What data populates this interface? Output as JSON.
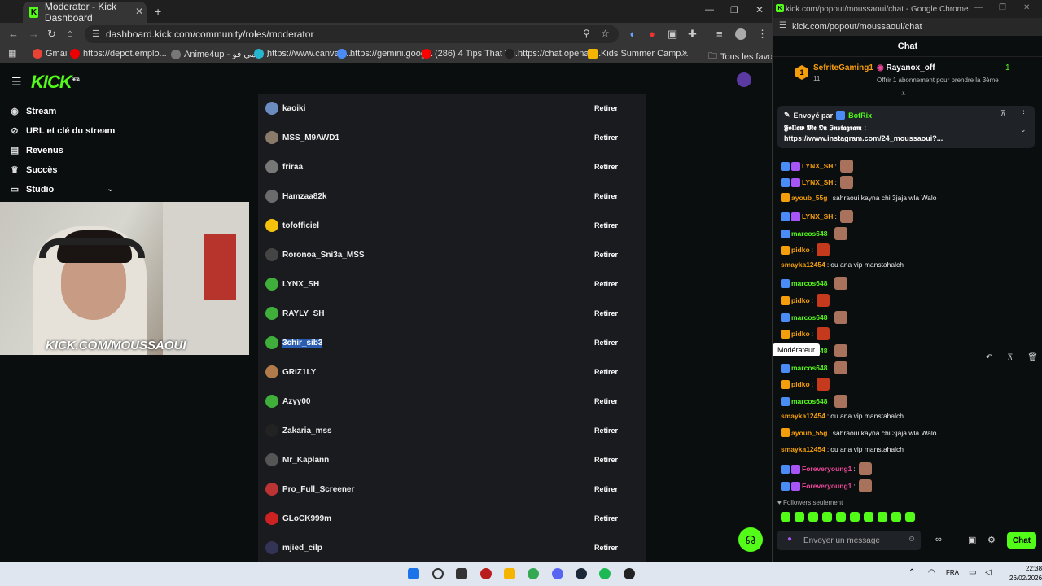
{
  "left_browser": {
    "tab_title": "Moderator - Kick Dashboard",
    "url": "dashboard.kick.com/community/roles/moderator",
    "bookmarks": [
      "Gmail",
      "https://depot.emplo...",
      "Anime4up - انمي فو...",
      "https://www.canva.c...",
      "https://gemini.goog...",
      "(286) 4 Tips That Wi...",
      "https://chat.openai....",
      "Kids Summer Camp..."
    ],
    "bookmarks_folder": "Tous les favoris"
  },
  "kick": {
    "logo": "KICK",
    "beta": "BETA",
    "sidebar": [
      {
        "label": "Stream",
        "icon": "broadcast-icon"
      },
      {
        "label": "URL et clé du stream",
        "icon": "link-icon"
      },
      {
        "label": "Revenus",
        "icon": "revenue-icon"
      },
      {
        "label": "Succès",
        "icon": "trophy-icon"
      },
      {
        "label": "Studio",
        "icon": "monitor-icon"
      }
    ],
    "cam_overlay": "KICK.COM/MOUSSAOUI",
    "remove_label": "Retirer",
    "moderators": [
      "kaoiki",
      "MSS_M9AWD1",
      "friraa",
      "Hamzaa82k",
      "tofofficiel",
      "Roronoa_Sni3a_MSS",
      "LYNX_SH",
      "RAYLY_SH",
      "3chir_sib3",
      "GRIZ1LY",
      "Azyy00",
      "Zakaria_mss",
      "Mr_Kaplann",
      "Pro_Full_Screener",
      "GLoCK999m",
      "mjied_cilp"
    ],
    "colors": {
      "accent": "#53fc18",
      "panel": "#191b1f",
      "bg": "#0b0e0f",
      "highlight": "#2a5db0"
    }
  },
  "right_window": {
    "title": "kick.com/popout/moussaoui/chat - Google Chrome",
    "url": "kick.com/popout/moussaoui/chat",
    "chat_header": "Chat",
    "leader_name": "SefriteGaming1",
    "leader_count": "11",
    "leader_rank": "1",
    "opponent": "Rayanox_off",
    "opponent_note": "Offrir 1 abonnement pour prendre la 3ème",
    "opponent_count": "1",
    "pinned_by_label": "Envoyé par",
    "pinned_by": "BotRix",
    "pinned_line1": "𝕱𝖔𝖑𝖑𝖔𝖜 𝕸𝖊 𝕺𝖓 𝕴𝖓𝖘𝖙𝖆𝖌𝖗𝖆𝖒 :",
    "pinned_link": "https://www.instagram.com/24_moussaoui?...",
    "tooltip": "Modérateur",
    "messages": [
      {
        "user": "LYNX_SH",
        "text": "",
        "color": "#f59e0b"
      },
      {
        "user": "LYNX_SH",
        "text": "",
        "color": "#f59e0b"
      },
      {
        "user": "ayoub_55g",
        "text": "sahraoui kayna chi 3jaja wla Walo",
        "color": "#f59e0b"
      },
      {
        "user": "LYNX_SH",
        "text": "",
        "color": "#f59e0b"
      },
      {
        "user": "marcos648",
        "text": "",
        "color": "#53fc18"
      },
      {
        "user": "pidko",
        "text": "",
        "color": "#f59e0b"
      },
      {
        "user": "smayka12454",
        "text": "ou ana vip manstahalch",
        "color": "#f59e0b"
      },
      {
        "user": "marcos648",
        "text": "",
        "color": "#53fc18"
      },
      {
        "user": "pidko",
        "text": "",
        "color": "#f59e0b"
      },
      {
        "user": "marcos648",
        "text": "",
        "color": "#53fc18"
      },
      {
        "user": "pidko",
        "text": "",
        "color": "#f59e0b"
      },
      {
        "user": "marcos648",
        "text": "",
        "color": "#53fc18"
      },
      {
        "user": "marcos648",
        "text": "",
        "color": "#53fc18"
      },
      {
        "user": "pidko",
        "text": "",
        "color": "#f59e0b"
      },
      {
        "user": "marcos648",
        "text": "",
        "color": "#53fc18"
      },
      {
        "user": "smayka12454",
        "text": "ou ana vip manstahalch",
        "color": "#f59e0b"
      },
      {
        "user": "ayoub_55g",
        "text": "sahraoui kayna chi 3jaja wla Walo",
        "color": "#f59e0b"
      },
      {
        "user": "smayka12454",
        "text": "ou ana vip manstahalch",
        "color": "#f59e0b"
      },
      {
        "user": "Foreveryoung1",
        "text": "",
        "color": "#ec4899"
      },
      {
        "user": "Foreveryoung1",
        "text": "",
        "color": "#ec4899"
      }
    ],
    "followers_only": "Followers seulement",
    "input_placeholder": "Envoyer un message",
    "chat_button": "Chat"
  },
  "taskbar": {
    "lang": "FRA",
    "time": "22:38",
    "date": "26/02/2026"
  }
}
